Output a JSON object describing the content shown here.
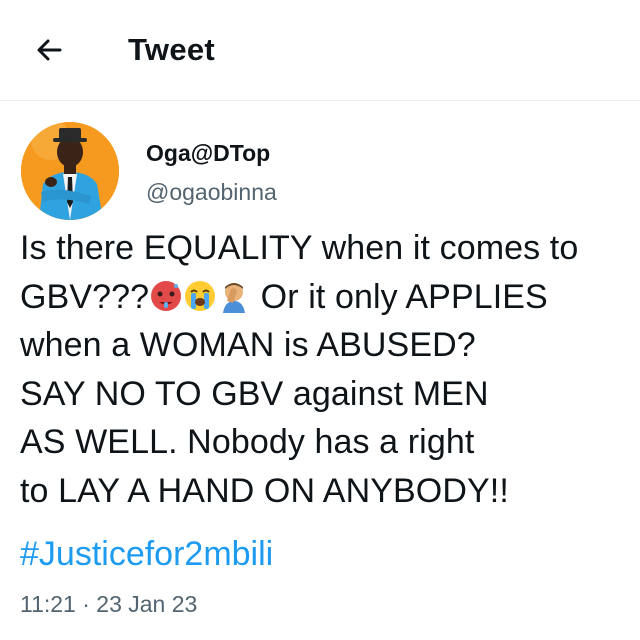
{
  "header": {
    "back_icon": "arrow-left-icon",
    "title": "Tweet"
  },
  "author": {
    "display_name": "Oga@DTop",
    "handle": "@ogaobinna",
    "avatar_bg": "#f59a1e"
  },
  "tweet": {
    "line1": "Is there EQUALITY when it comes to",
    "line2_pre": "GBV???",
    "line2_emojis": [
      "hot-face-emoji",
      "loudly-crying-face-emoji",
      "person-facepalming-emoji"
    ],
    "line2_post": " Or it only APPLIES",
    "line3": "when a WOMAN is ABUSED?",
    "line4": "SAY NO TO GBV against MEN",
    "line5": "AS WELL. Nobody has a right",
    "line6": "to LAY A HAND ON ANYBODY!!",
    "hashtag": "#Justicefor2mbili",
    "timestamp": "11:21 · 23 Jan 23"
  },
  "colors": {
    "link": "#1d9bf0",
    "secondary_text": "#536471",
    "divider": "#e6ecf0"
  }
}
